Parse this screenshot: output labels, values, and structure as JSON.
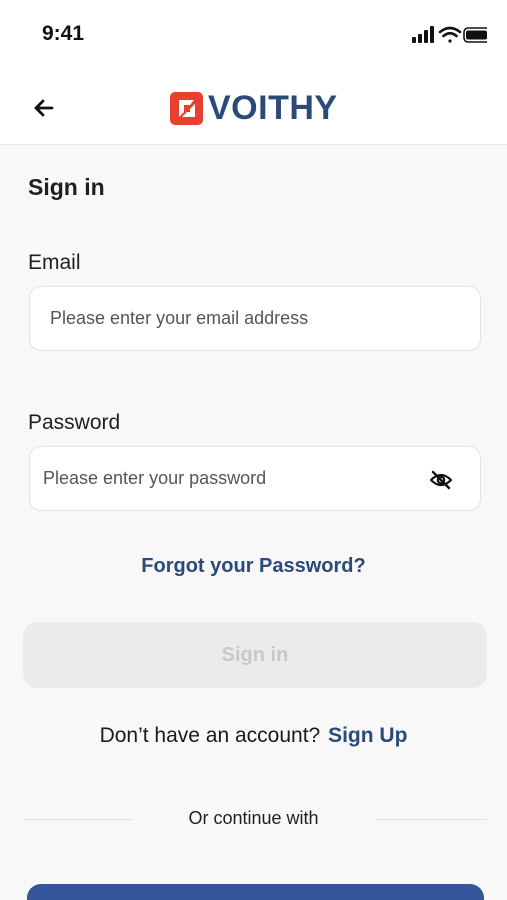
{
  "status_bar": {
    "time": "9:41",
    "icons": [
      "cellular-signal-icon",
      "wifi-icon",
      "battery-icon"
    ]
  },
  "header": {
    "back_icon": "arrow-left-icon",
    "brand_name": "VOITHY",
    "brand_colors": {
      "mark": "#e8402f",
      "text": "#2b4a7a"
    }
  },
  "form": {
    "title": "Sign in",
    "email": {
      "label": "Email",
      "placeholder": "Please enter your email address",
      "value": ""
    },
    "password": {
      "label": "Password",
      "placeholder": "Please enter your password",
      "value": "",
      "toggle_icon": "eye-off-icon"
    },
    "forgot_link": "Forgot your Password?",
    "submit_label": "Sign in",
    "submit_enabled": false
  },
  "signup": {
    "prompt": "Don’t have an account?",
    "link": "Sign Up"
  },
  "divider": {
    "text": "Or continue with"
  },
  "colors": {
    "accent": "#2b4a7a",
    "social_button": "#35569a",
    "disabled_button": "#ebebeb",
    "background": "#f8f8f8"
  }
}
